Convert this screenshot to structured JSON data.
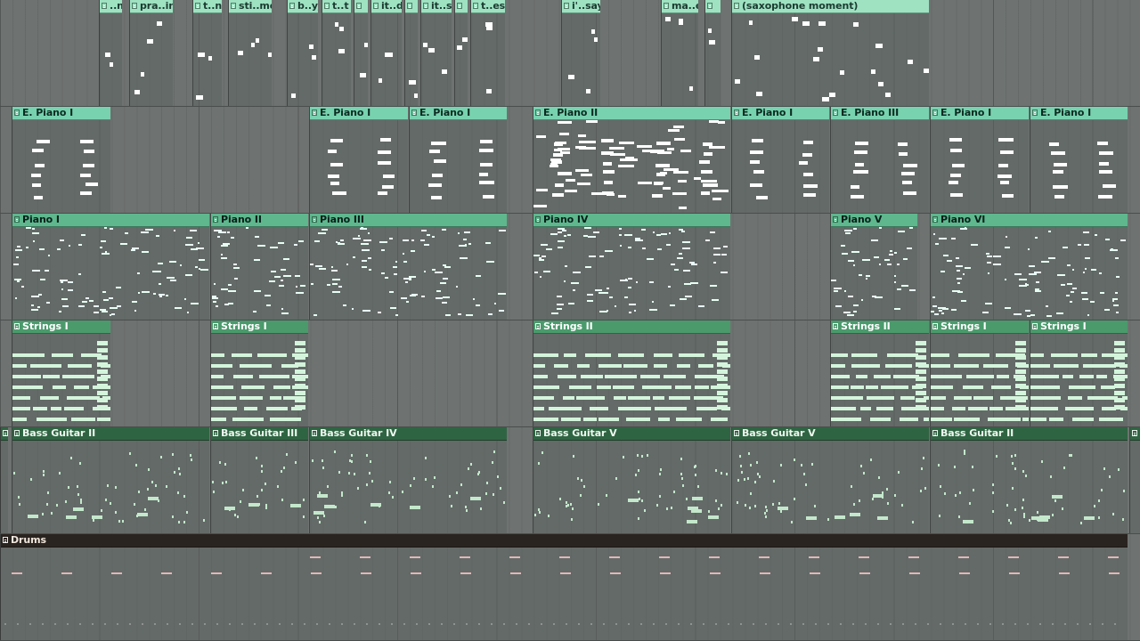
{
  "colors": {
    "vocal_header": "#9ee2c2",
    "vocal_name": "#1c3a30",
    "vocal_note": "#ffffff",
    "epiano_header": "#78d2b0",
    "epiano_name": "#0c2a20",
    "epiano_note": "#ffffff",
    "piano_header": "#5fb78e",
    "piano_name": "#06201a",
    "piano_note": "#e8fff4",
    "strings_header": "#4a9a6c",
    "strings_name": "#ffffff",
    "strings_note": "#d4f5dc",
    "bass_header": "#2f6442",
    "bass_name": "#eef8ef",
    "bass_note": "#c4e8cc",
    "drums_header": "#2a2420",
    "drums_name": "#f0e6dc",
    "drums_note": "#e2b7b7"
  },
  "playlist": {
    "tracks": [
      {
        "id": "vocals",
        "clips": [
          {
            "label": "..n",
            "width_bars": 0.25
          },
          {
            "label": "pra..in",
            "width_bars": 0.45
          },
          {
            "label": "t..n",
            "width_bars": 0.3
          },
          {
            "label": "sti..me",
            "width_bars": 0.45
          },
          {
            "label": "b..y,",
            "width_bars": 0.3
          },
          {
            "label": "t..t",
            "width_bars": 0.3
          },
          {
            "label": "",
            "width_bars": 0.15
          },
          {
            "label": "it..d",
            "width_bars": 0.3
          },
          {
            "label": "",
            "width_bars": 0.15
          },
          {
            "label": "it..s",
            "width_bars": 0.3
          },
          {
            "label": "",
            "width_bars": 0.15
          },
          {
            "label": "t..es",
            "width_bars": 0.35
          },
          {
            "label": "i'..say",
            "width_bars": 0.4
          },
          {
            "label": "ma..e",
            "width_bars": 0.4
          },
          {
            "label": "",
            "width_bars": 0.18
          },
          {
            "label": "(saxophone moment)",
            "width_bars": 2
          }
        ]
      },
      {
        "id": "epiano",
        "clips": [
          {
            "label": "E. Piano I",
            "width_bars": 1
          },
          {
            "label": "E. Piano I",
            "width_bars": 1
          },
          {
            "label": "E. Piano I",
            "width_bars": 1
          },
          {
            "label": "E. Piano II",
            "width_bars": 2
          },
          {
            "label": "E. Piano I",
            "width_bars": 1
          },
          {
            "label": "E. Piano III",
            "width_bars": 1
          },
          {
            "label": "E. Piano I",
            "width_bars": 1
          },
          {
            "label": "E. Piano I",
            "width_bars": 1
          }
        ]
      },
      {
        "id": "piano",
        "clips": [
          {
            "label": "Piano I",
            "width_bars": 2
          },
          {
            "label": "Piano II",
            "width_bars": 1
          },
          {
            "label": "Piano III",
            "width_bars": 2
          },
          {
            "label": "Piano IV",
            "width_bars": 2
          },
          {
            "label": "Piano V",
            "width_bars": 1
          },
          {
            "label": "Piano VI",
            "width_bars": 2
          }
        ]
      },
      {
        "id": "strings",
        "clips": [
          {
            "label": "Strings I",
            "width_bars": 1
          },
          {
            "label": "Strings I",
            "width_bars": 1
          },
          {
            "label": "Strings II",
            "width_bars": 2
          },
          {
            "label": "Strings II",
            "width_bars": 1
          },
          {
            "label": "Strings I",
            "width_bars": 1
          },
          {
            "label": "Strings I",
            "width_bars": 1
          }
        ]
      },
      {
        "id": "bass",
        "clips": [
          {
            "label": "",
            "width_bars": 0.1
          },
          {
            "label": "Bass Guitar II",
            "width_bars": 2
          },
          {
            "label": "Bass Guitar III",
            "width_bars": 1
          },
          {
            "label": "Bass Guitar IV",
            "width_bars": 2
          },
          {
            "label": "Bass Guitar V",
            "width_bars": 2
          },
          {
            "label": "Bass Guitar V",
            "width_bars": 2
          },
          {
            "label": "Bass Guitar II",
            "width_bars": 2
          },
          {
            "label": "",
            "width_bars": 0.1
          }
        ]
      },
      {
        "id": "drums",
        "clips": [
          {
            "label": "Drums",
            "width_bars": 11
          }
        ]
      }
    ]
  }
}
